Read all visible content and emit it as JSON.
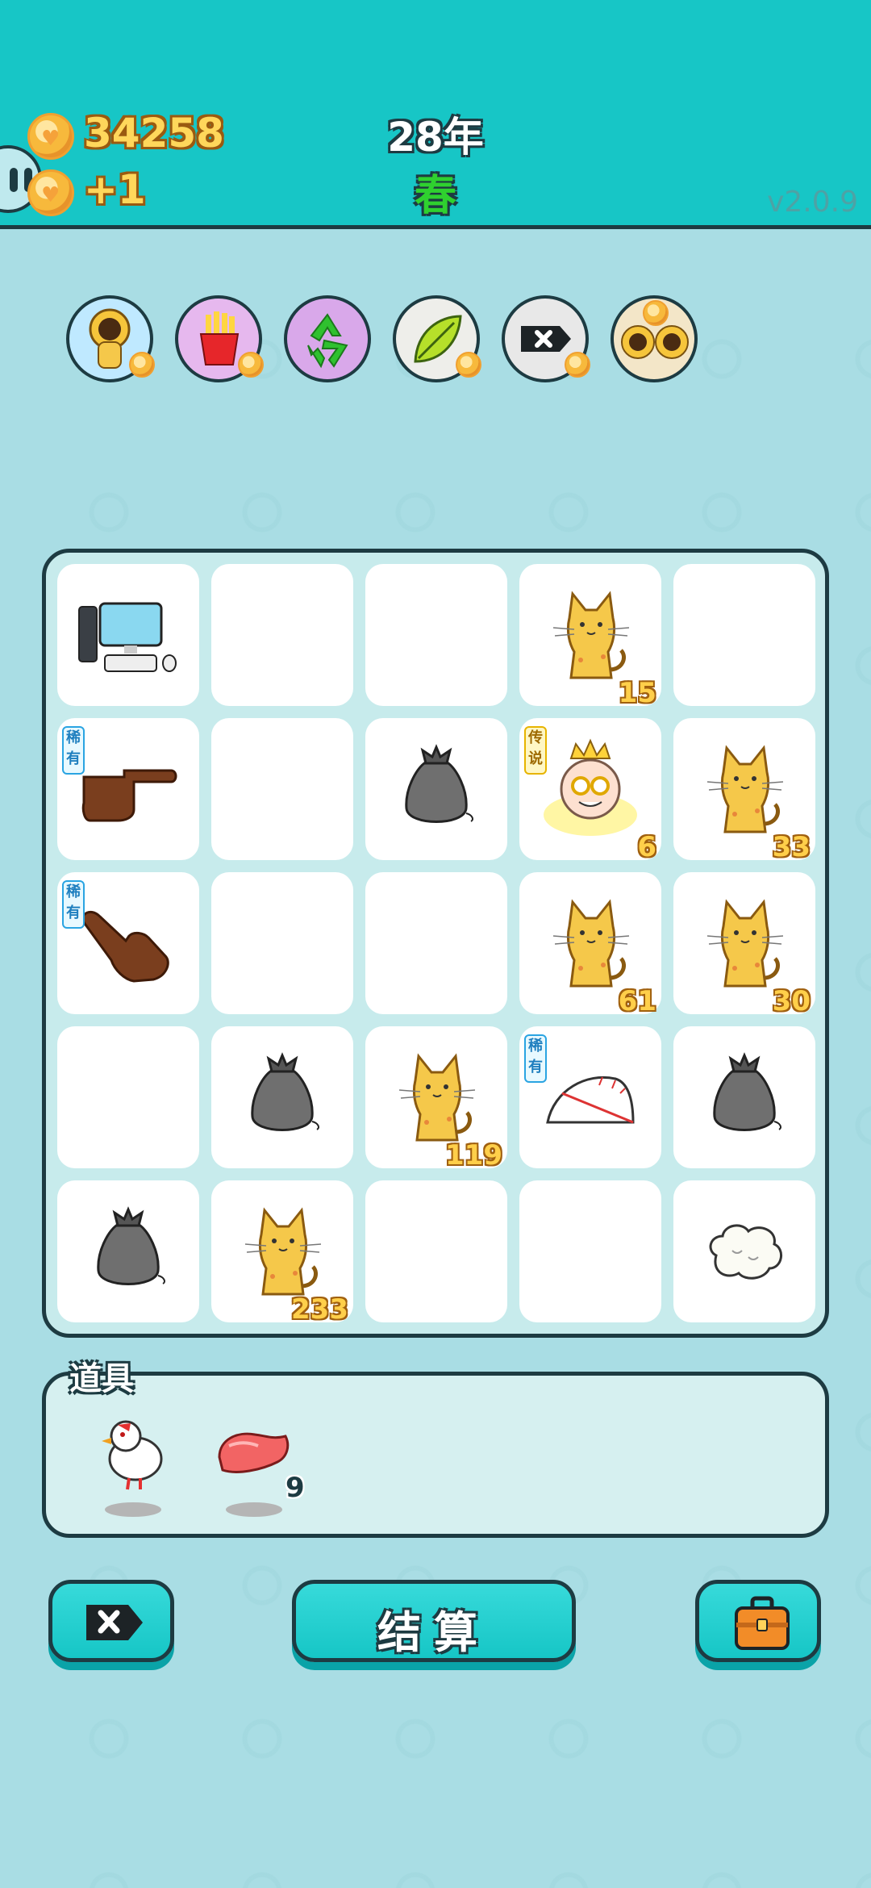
{
  "header": {
    "coins": "34258",
    "income": "+1",
    "year": "28年",
    "season": "春",
    "version": "v2.0.9"
  },
  "effects": [
    {
      "icon": "cat-sunflower-icon",
      "bg": "#bfe9ff"
    },
    {
      "icon": "french-fries-icon",
      "bg": "#e6b8ee"
    },
    {
      "icon": "recycle-icon",
      "bg": "#d9a8ea"
    },
    {
      "icon": "leaf-icon",
      "bg": "#eeeeea"
    },
    {
      "icon": "delete-tag-icon",
      "bg": "#e8e8e8"
    },
    {
      "icon": "twin-sunflower-cats-icon",
      "bg": "#f3e6c8"
    }
  ],
  "board": {
    "rows": [
      [
        {
          "item": "computer-icon",
          "count": "",
          "tag": ""
        },
        {
          "item": "",
          "count": "",
          "tag": ""
        },
        {
          "item": "",
          "count": "",
          "tag": ""
        },
        {
          "item": "cat-icon",
          "count": "15",
          "tag": ""
        },
        {
          "item": "",
          "count": "",
          "tag": ""
        }
      ],
      [
        {
          "item": "pointing-hand-right-icon",
          "count": "",
          "tag": "稀有"
        },
        {
          "item": "",
          "count": "",
          "tag": ""
        },
        {
          "item": "garbage-bag-icon",
          "count": "",
          "tag": ""
        },
        {
          "item": "king-icon",
          "count": "6",
          "tag": "传说"
        },
        {
          "item": "cat-icon",
          "count": "33",
          "tag": ""
        }
      ],
      [
        {
          "item": "pointing-hand-down-right-icon",
          "count": "",
          "tag": "稀有"
        },
        {
          "item": "",
          "count": "",
          "tag": ""
        },
        {
          "item": "",
          "count": "",
          "tag": ""
        },
        {
          "item": "cat-icon",
          "count": "61",
          "tag": ""
        },
        {
          "item": "cat-icon",
          "count": "30",
          "tag": ""
        }
      ],
      [
        {
          "item": "",
          "count": "",
          "tag": ""
        },
        {
          "item": "garbage-bag-icon",
          "count": "",
          "tag": ""
        },
        {
          "item": "cat-icon",
          "count": "119",
          "tag": ""
        },
        {
          "item": "folding-fan-icon",
          "count": "",
          "tag": "稀有"
        },
        {
          "item": "garbage-bag-icon",
          "count": "",
          "tag": ""
        }
      ],
      [
        {
          "item": "garbage-bag-icon",
          "count": "",
          "tag": ""
        },
        {
          "item": "cat-icon",
          "count": "233",
          "tag": ""
        },
        {
          "item": "",
          "count": "",
          "tag": ""
        },
        {
          "item": "",
          "count": "",
          "tag": ""
        },
        {
          "item": "cotton-icon",
          "count": "",
          "tag": ""
        }
      ]
    ]
  },
  "items": {
    "label": "道具",
    "list": [
      {
        "icon": "white-bird-icon",
        "count": ""
      },
      {
        "icon": "raw-meat-icon",
        "count": "9"
      }
    ]
  },
  "buttons": {
    "delete_icon": "delete-tag-icon",
    "settle_label": "结算",
    "bag_icon": "briefcase-icon"
  },
  "colors": {
    "header": "#17c6c6",
    "background": "#a9dde4",
    "outline": "#1d3b42",
    "coin": "#f7b93c",
    "season": "#2fd12f"
  }
}
